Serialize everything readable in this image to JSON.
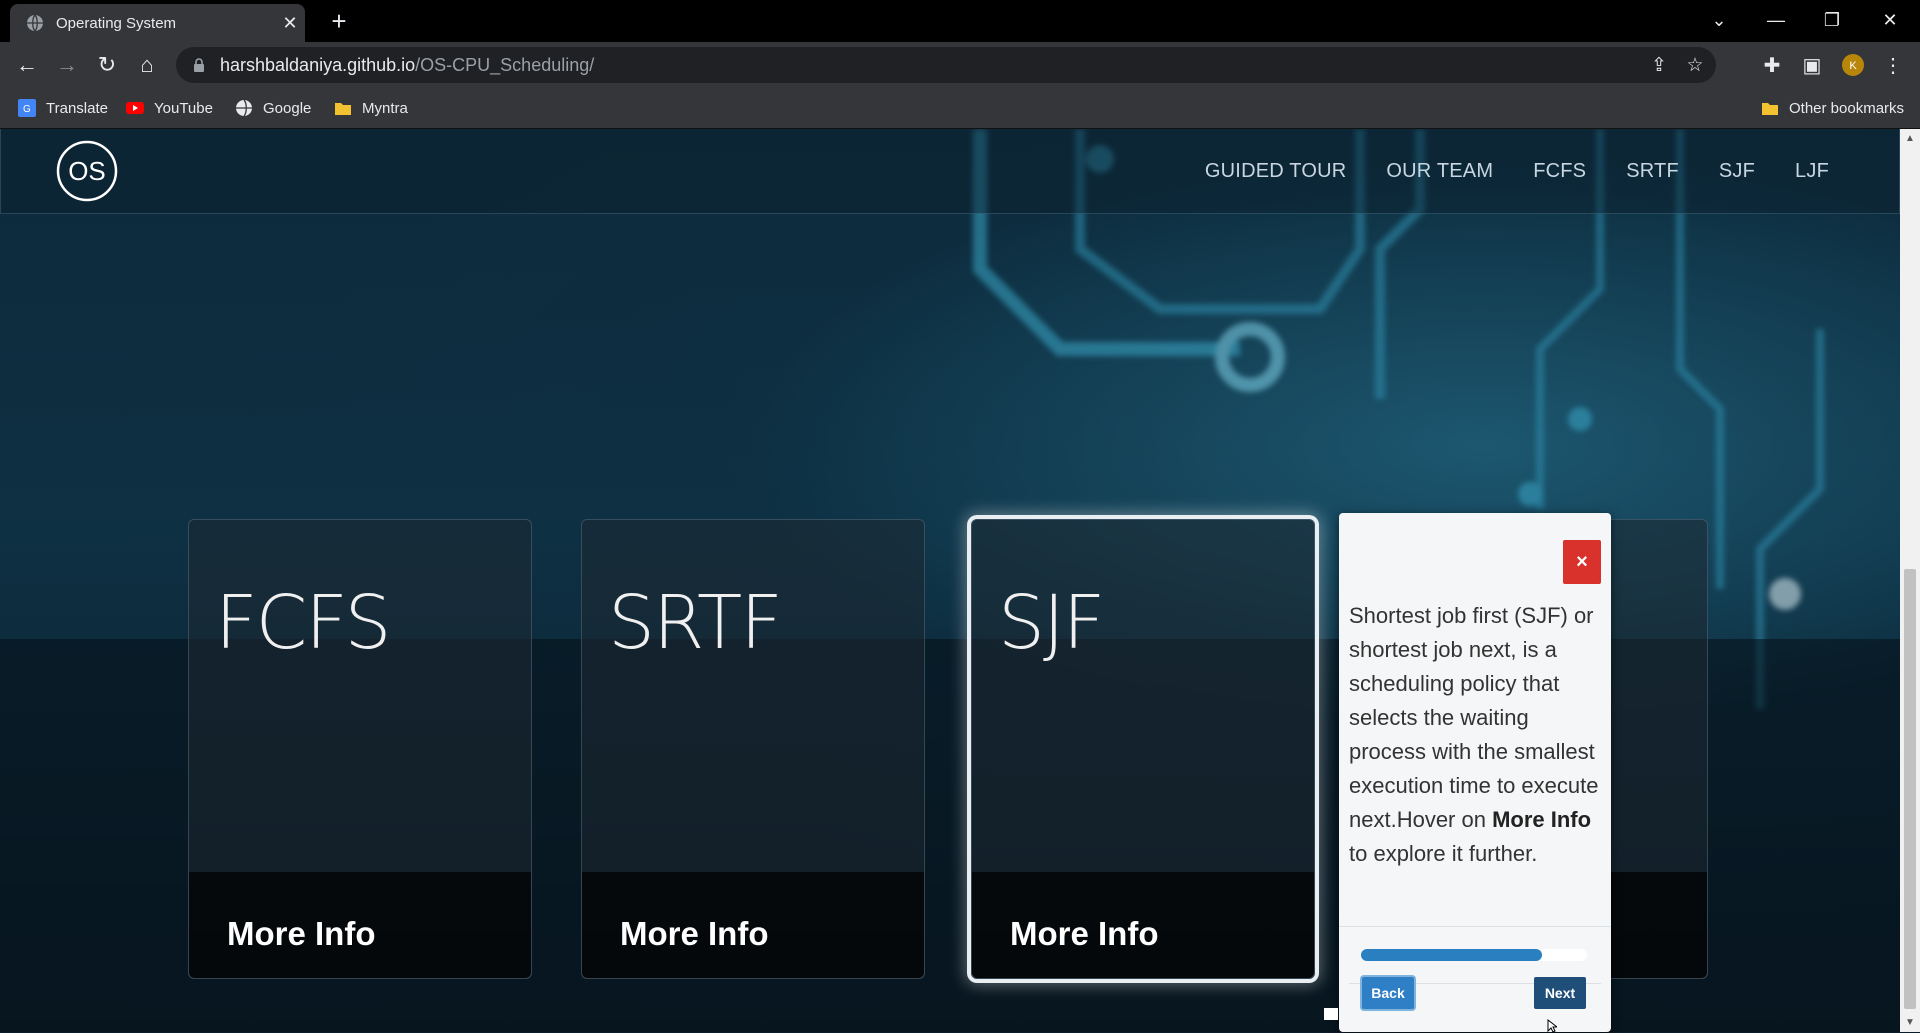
{
  "browser": {
    "tab_title": "Operating System",
    "url_host": "harshbaldaniya.github.io",
    "url_path": "/OS-CPU_Scheduling/",
    "bookmarks": [
      {
        "label": "Translate",
        "icon": "google-translate-icon"
      },
      {
        "label": "YouTube",
        "icon": "youtube-icon"
      },
      {
        "label": "Google",
        "icon": "globe-icon"
      },
      {
        "label": "Myntra",
        "icon": "folder-icon"
      }
    ],
    "other_bookmarks": "Other bookmarks"
  },
  "site": {
    "logo_text": "OS",
    "nav": [
      "GUIDED TOUR",
      "OUR TEAM",
      "FCFS",
      "SRTF",
      "SJF",
      "LJF"
    ]
  },
  "cards": [
    {
      "title": "FCFS",
      "more": "More Info"
    },
    {
      "title": "SRTF",
      "more": "More Info"
    },
    {
      "title": "SJF",
      "more": "More Info"
    }
  ],
  "tour": {
    "close_label": "×",
    "text_before": "Shortest job first (SJF) or shortest job next, is a scheduling policy that selects the waiting process with the smallest execution time to execute next.Hover on ",
    "text_bold": "More Info",
    "text_after": " to explore it further.",
    "progress": 0.8,
    "back_label": "Back",
    "next_label": "Next"
  },
  "colors": {
    "accent_blue": "#2a7fc1",
    "close_red": "#d9322c",
    "next_button": "#1f4e79"
  }
}
